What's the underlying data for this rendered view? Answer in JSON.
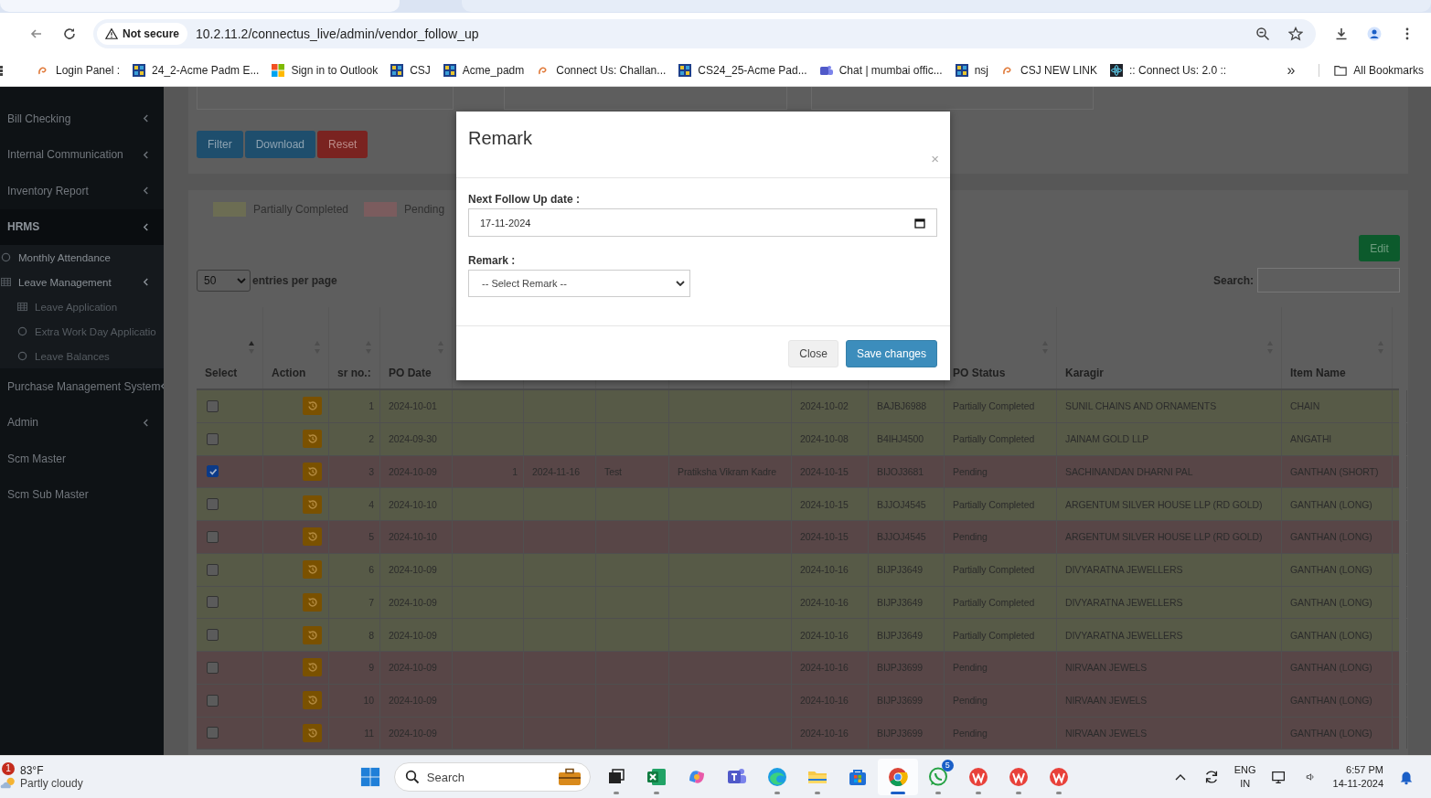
{
  "browser": {
    "security": "Not secure",
    "url": "10.2.11.2/connectus_live/admin/vendor_follow_up",
    "bookmarks": [
      {
        "label": "Login Panel :",
        "kind": "swirl"
      },
      {
        "label": "24_2-Acme Padm E...",
        "kind": "grid"
      },
      {
        "label": "Sign in to Outlook",
        "kind": "windows"
      },
      {
        "label": "CSJ",
        "kind": "grid"
      },
      {
        "label": "Acme_padm",
        "kind": "grid"
      },
      {
        "label": "Connect Us: Challan...",
        "kind": "swirl"
      },
      {
        "label": "CS24_25-Acme Pad...",
        "kind": "grid"
      },
      {
        "label": "Chat | mumbai offic...",
        "kind": "teams"
      },
      {
        "label": "nsj",
        "kind": "grid"
      },
      {
        "label": "CSJ NEW LINK",
        "kind": "swirl"
      },
      {
        "label": ":: Connect Us: 2.0 ::",
        "kind": "atom"
      }
    ],
    "overflow": "»",
    "all_bookmarks": "All Bookmarks"
  },
  "sidebar": {
    "items": [
      {
        "label": "Bill Checking",
        "expanded": false
      },
      {
        "label": "Internal Communication",
        "expanded": false
      },
      {
        "label": "Inventory Report",
        "expanded": false
      },
      {
        "label": "HRMS",
        "expanded": true,
        "children": [
          {
            "label": "Monthly Attendance",
            "kind": "circle"
          },
          {
            "label": "Leave Management",
            "kind": "table",
            "expanded": true,
            "children": [
              {
                "label": "Leave Application",
                "kind": "table"
              },
              {
                "label": "Extra Work Day Applicatio",
                "kind": "circle"
              },
              {
                "label": "Leave Balances",
                "kind": "circle"
              }
            ]
          }
        ]
      },
      {
        "label": "Purchase Management System",
        "expanded": false
      },
      {
        "label": "Admin",
        "expanded": false
      },
      {
        "label": "Scm Master"
      },
      {
        "label": "Scm Sub Master"
      }
    ]
  },
  "filters": {
    "buttons": [
      {
        "label": "Filter",
        "kind": "primary"
      },
      {
        "label": "Download",
        "kind": "primary"
      },
      {
        "label": "Reset",
        "kind": "danger"
      }
    ]
  },
  "legend": [
    {
      "label": "Partially Completed",
      "kind": "partial"
    },
    {
      "label": "Pending",
      "kind": "pending"
    }
  ],
  "edit_button": "Edit",
  "entries": {
    "value": "50",
    "label": "entries per page"
  },
  "search": {
    "label": "Search:"
  },
  "table": {
    "columns": [
      {
        "label": "Select",
        "sorted": true
      },
      {
        "label": "Action",
        "sorted": false
      },
      {
        "label": "sr no.:",
        "sorted": false
      },
      {
        "label": "PO Date",
        "sorted": false
      },
      {},
      {},
      {},
      {},
      {},
      {},
      {
        "label": "PO Status",
        "sorted": false
      },
      {
        "label": "Karagir",
        "sorted": false
      },
      {
        "label": "Item Name",
        "sorted": false
      },
      {}
    ],
    "rows": [
      {
        "kind": "partial",
        "checked": false,
        "cells": [
          "",
          "",
          "1",
          "2024-10-01",
          "",
          "",
          "",
          "",
          "2024-10-02",
          "BAJBJ6988",
          "Partially Completed",
          "SUNIL CHAINS AND ORNAMENTS",
          "CHAIN",
          ""
        ]
      },
      {
        "kind": "partial",
        "checked": false,
        "cells": [
          "",
          "",
          "2",
          "2024-09-30",
          "",
          "",
          "",
          "",
          "2024-10-08",
          "B4IHJ4500",
          "Partially Completed",
          "JAINAM GOLD LLP",
          "ANGATHI",
          ""
        ]
      },
      {
        "kind": "pending",
        "checked": true,
        "cells": [
          "",
          "",
          "3",
          "2024-10-09",
          "1",
          "2024-11-16",
          "Test",
          "Pratiksha Vikram Kadre",
          "2024-10-15",
          "BIJOJ3681",
          "Pending",
          "SACHINANDAN DHARNI PAL",
          "GANTHAN (SHORT)",
          ""
        ]
      },
      {
        "kind": "partial",
        "checked": false,
        "cells": [
          "",
          "",
          "4",
          "2024-10-10",
          "",
          "",
          "",
          "",
          "2024-10-15",
          "BJJOJ4545",
          "Partially Completed",
          "ARGENTUM SILVER HOUSE LLP (RD GOLD)",
          "GANTHAN (LONG)",
          ""
        ]
      },
      {
        "kind": "pending",
        "checked": false,
        "cells": [
          "",
          "",
          "5",
          "2024-10-10",
          "",
          "",
          "",
          "",
          "2024-10-15",
          "BJJOJ4545",
          "Pending",
          "ARGENTUM SILVER HOUSE LLP (RD GOLD)",
          "GANTHAN (LONG)",
          ""
        ]
      },
      {
        "kind": "partial",
        "checked": false,
        "cells": [
          "",
          "",
          "6",
          "2024-10-09",
          "",
          "",
          "",
          "",
          "2024-10-16",
          "BIJPJ3649",
          "Partially Completed",
          "DIVYARATNA JEWELLERS",
          "GANTHAN (LONG)",
          ""
        ]
      },
      {
        "kind": "partial",
        "checked": false,
        "cells": [
          "",
          "",
          "7",
          "2024-10-09",
          "",
          "",
          "",
          "",
          "2024-10-16",
          "BIJPJ3649",
          "Partially Completed",
          "DIVYARATNA JEWELLERS",
          "GANTHAN (LONG)",
          ""
        ]
      },
      {
        "kind": "partial",
        "checked": false,
        "cells": [
          "",
          "",
          "8",
          "2024-10-09",
          "",
          "",
          "",
          "",
          "2024-10-16",
          "BIJPJ3649",
          "Partially Completed",
          "DIVYARATNA JEWELLERS",
          "GANTHAN (LONG)",
          ""
        ]
      },
      {
        "kind": "pending",
        "checked": false,
        "cells": [
          "",
          "",
          "9",
          "2024-10-09",
          "",
          "",
          "",
          "",
          "2024-10-16",
          "BIJPJ3699",
          "Pending",
          "NIRVAAN JEWELS",
          "GANTHAN (LONG)",
          ""
        ]
      },
      {
        "kind": "pending",
        "checked": false,
        "cells": [
          "",
          "",
          "10",
          "2024-10-09",
          "",
          "",
          "",
          "",
          "2024-10-16",
          "BIJPJ3699",
          "Pending",
          "NIRVAAN JEWELS",
          "GANTHAN (LONG)",
          ""
        ]
      },
      {
        "kind": "pending",
        "checked": false,
        "cells": [
          "",
          "",
          "11",
          "2024-10-09",
          "",
          "",
          "",
          "",
          "2024-10-16",
          "BIJPJ3699",
          "Pending",
          "NIRVAAN JEWELS",
          "GANTHAN (LONG)",
          ""
        ]
      }
    ]
  },
  "modal": {
    "title": "Remark",
    "close": "×",
    "fields": [
      {
        "label": "Next Follow Up date :",
        "kind": "date",
        "value": "17-11-2024"
      },
      {
        "label": "Remark :",
        "kind": "select",
        "value": "-- Select Remark --"
      }
    ],
    "buttons": [
      {
        "label": "Close",
        "kind": "secondary"
      },
      {
        "label": "Save changes",
        "kind": "primary"
      }
    ]
  },
  "taskbar": {
    "weather": {
      "badge": "1",
      "temperature": "83°F",
      "condition": "Partly cloudy"
    },
    "search": {
      "placeholder": "Search"
    },
    "apps": [
      {
        "kind": "tasks",
        "running": true,
        "selected": false
      },
      {
        "kind": "excel",
        "running": true,
        "selected": false
      },
      {
        "kind": "copilot",
        "running": false,
        "selected": false
      },
      {
        "kind": "teams",
        "running": false,
        "selected": false
      },
      {
        "kind": "edge",
        "running": true,
        "selected": false
      },
      {
        "kind": "folder",
        "running": true,
        "selected": false
      },
      {
        "kind": "store",
        "running": false,
        "selected": false
      },
      {
        "kind": "chrome",
        "running": true,
        "selected": true
      },
      {
        "kind": "whatsapp",
        "running": true,
        "selected": false,
        "badge": "5"
      },
      {
        "kind": "wps",
        "running": true,
        "selected": false
      },
      {
        "kind": "wps",
        "running": true,
        "selected": false
      },
      {
        "kind": "wps",
        "running": true,
        "selected": false
      }
    ],
    "language": "ENG",
    "region": "IN",
    "time": "6:57 PM",
    "date": "14-11-2024"
  }
}
